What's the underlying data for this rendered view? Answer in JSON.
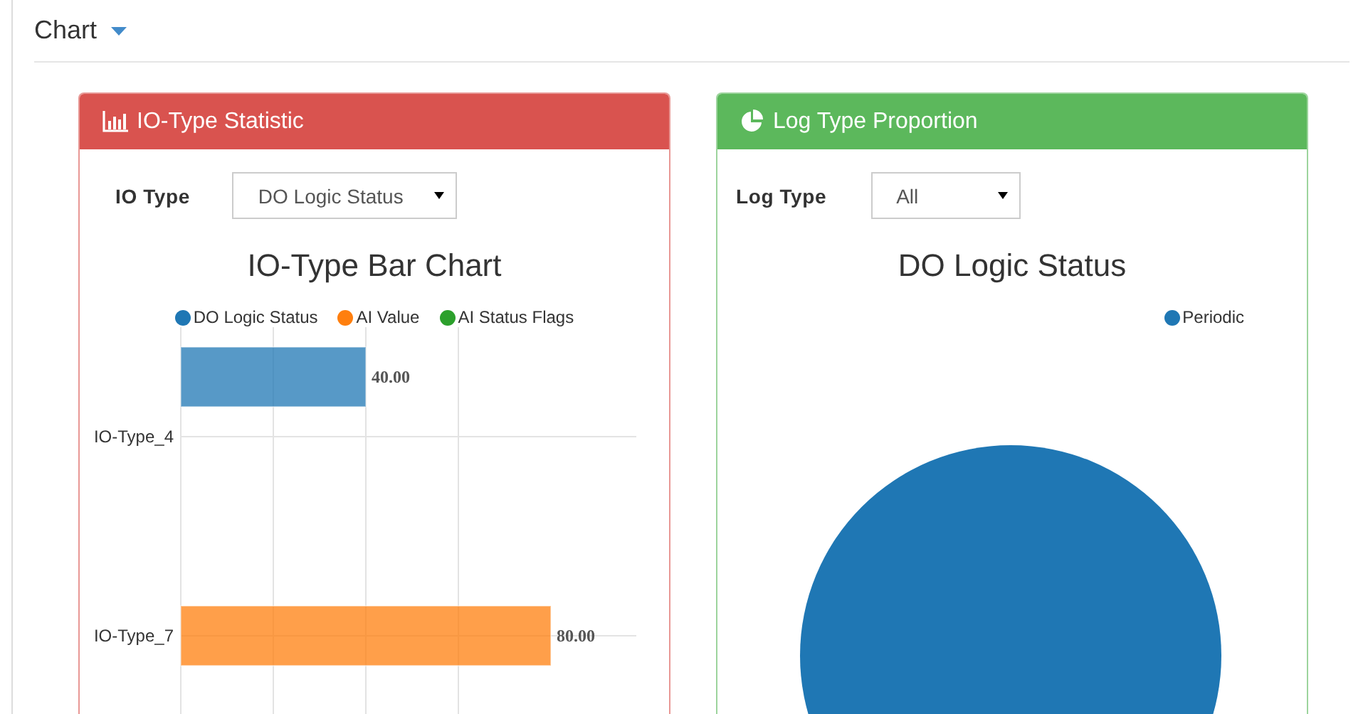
{
  "section": {
    "title": "Chart"
  },
  "panels": [
    {
      "title": "IO-Type Statistic",
      "color": "#d9534f",
      "filter": {
        "label": "IO Type",
        "value": "DO Logic Status"
      },
      "chart_data": {
        "type": "bar",
        "title": "IO-Type Bar Chart",
        "orientation": "horizontal",
        "categories": [
          "IO-Type_4",
          "IO-Type_7"
        ],
        "data_labels": true,
        "series": [
          {
            "name": "DO Logic Status",
            "color": "#1f77b4",
            "values": [
              40,
              null
            ],
            "value_labels": [
              "40.00",
              null
            ]
          },
          {
            "name": "AI Value",
            "color": "#ff7f0e",
            "values": [
              null,
              80
            ],
            "value_labels": [
              null,
              "80.00"
            ]
          },
          {
            "name": "AI Status Flags",
            "color": "#2ca02c",
            "values": [
              null,
              null
            ],
            "value_labels": [
              null,
              null
            ]
          }
        ]
      }
    },
    {
      "title": "Log Type Proportion",
      "color": "#5cb85c",
      "filter": {
        "label": "Log Type",
        "value": "All"
      },
      "chart_data": {
        "type": "pie",
        "title": "DO Logic Status",
        "series": [
          {
            "name": "Periodic",
            "color": "#1f77b4",
            "values": [
              1
            ]
          }
        ]
      }
    }
  ]
}
